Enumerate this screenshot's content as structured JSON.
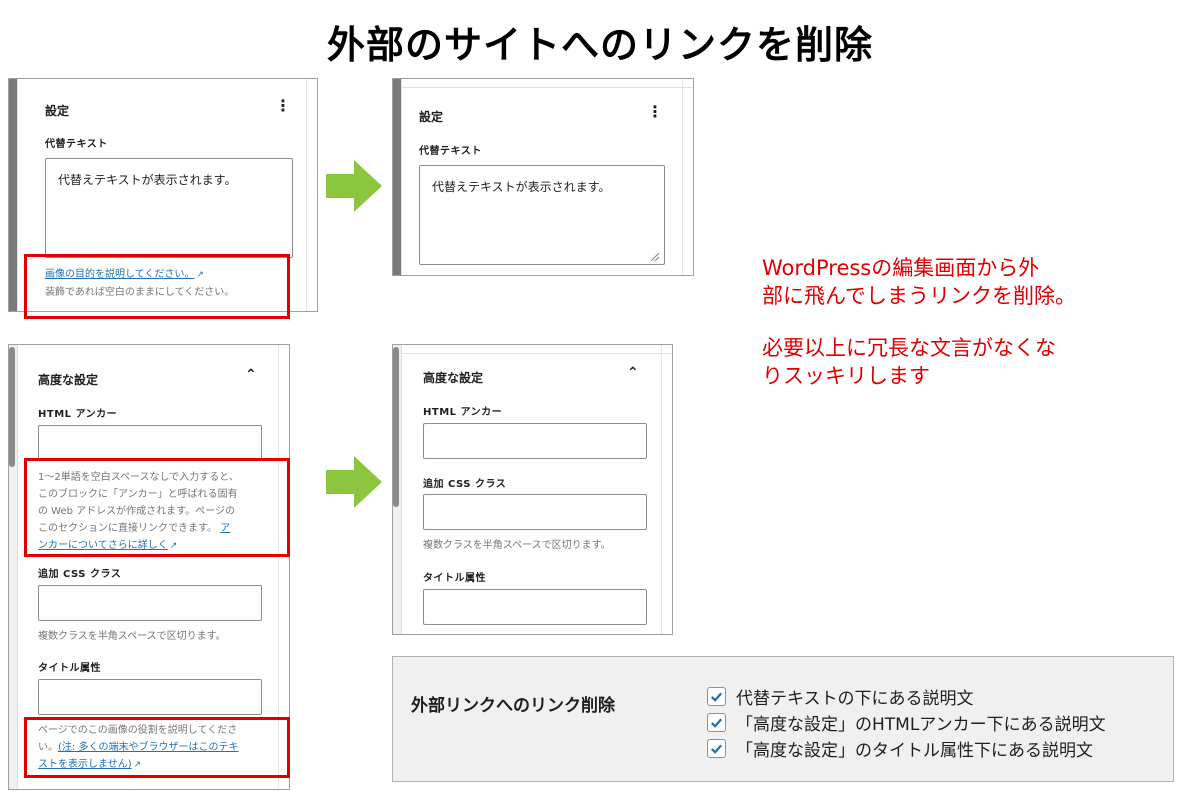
{
  "title": "外部のサイトへのリンクを削除",
  "settings_panel": {
    "heading": "設定",
    "alt_label": "代替テキスト",
    "alt_value": "代替えテキストが表示されます。",
    "help_link": "画像の目的を説明してください。",
    "help_text": "装飾であれば空白のままにしてください。"
  },
  "advanced_panel": {
    "heading": "高度な設定",
    "anchor_label": "HTML アンカー",
    "anchor_help_lines": [
      "1〜2単語を空白スペースなしで入力すると、",
      "このブロックに「アンカー」と呼ばれる固有",
      "の Web アドレスが作成されます。ページの",
      "このセクションに直接リンクできます。"
    ],
    "anchor_link_a": "ア",
    "anchor_link_b": "ンカーについてさらに詳しく",
    "css_label": "追加 CSS クラス",
    "css_help": "複数クラスを半角スペースで区切ります。",
    "title_label": "タイトル属性",
    "title_help_a": "ページでのこの画像の役割を説明してくださ",
    "title_help_b": "い。",
    "title_link_a": "(注: 多くの端末やブラウザーはこのテキ",
    "title_link_b": "ストを表示しません)"
  },
  "note": {
    "line1": "WordPressの編集画面から外",
    "line2": "部に飛んでしまうリンクを削除。",
    "line3": "必要以上に冗長な文言がなくな",
    "line4": "りスッキリします"
  },
  "options": {
    "title": "外部リンクへのリンク削除",
    "items": [
      {
        "label": "代替テキストの下にある説明文",
        "checked": true
      },
      {
        "label": "「高度な設定」のHTMLアンカー下にある説明文",
        "checked": true
      },
      {
        "label": "「高度な設定」のタイトル属性下にある説明文",
        "checked": true
      }
    ]
  },
  "icons": {
    "more": "more-vertical-icon",
    "collapse": "chevron-up-icon",
    "external": "external-link-icon",
    "arrow": "arrow-right-icon",
    "check": "check-icon"
  },
  "colors": {
    "accent_red": "#e00000",
    "arrow_green": "#8cc63f",
    "link_blue": "#2271b1",
    "checkbox_blue": "#2271b1"
  }
}
